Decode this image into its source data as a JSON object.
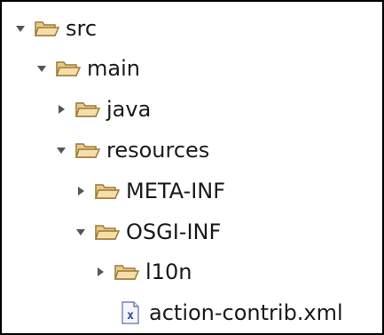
{
  "tree": {
    "items": [
      {
        "label": "src",
        "toggle": "expanded",
        "icon": "folder-open-icon"
      },
      {
        "label": "main",
        "toggle": "expanded",
        "icon": "folder-open-icon"
      },
      {
        "label": "java",
        "toggle": "collapsed",
        "icon": "folder-open-icon"
      },
      {
        "label": "resources",
        "toggle": "expanded",
        "icon": "folder-open-icon"
      },
      {
        "label": "META-INF",
        "toggle": "collapsed",
        "icon": "folder-open-icon"
      },
      {
        "label": "OSGI-INF",
        "toggle": "expanded",
        "icon": "folder-open-icon"
      },
      {
        "label": "l10n",
        "toggle": "collapsed",
        "icon": "folder-open-icon"
      },
      {
        "label": "action-contrib.xml",
        "toggle": "none",
        "icon": "xml-file-icon"
      }
    ]
  }
}
